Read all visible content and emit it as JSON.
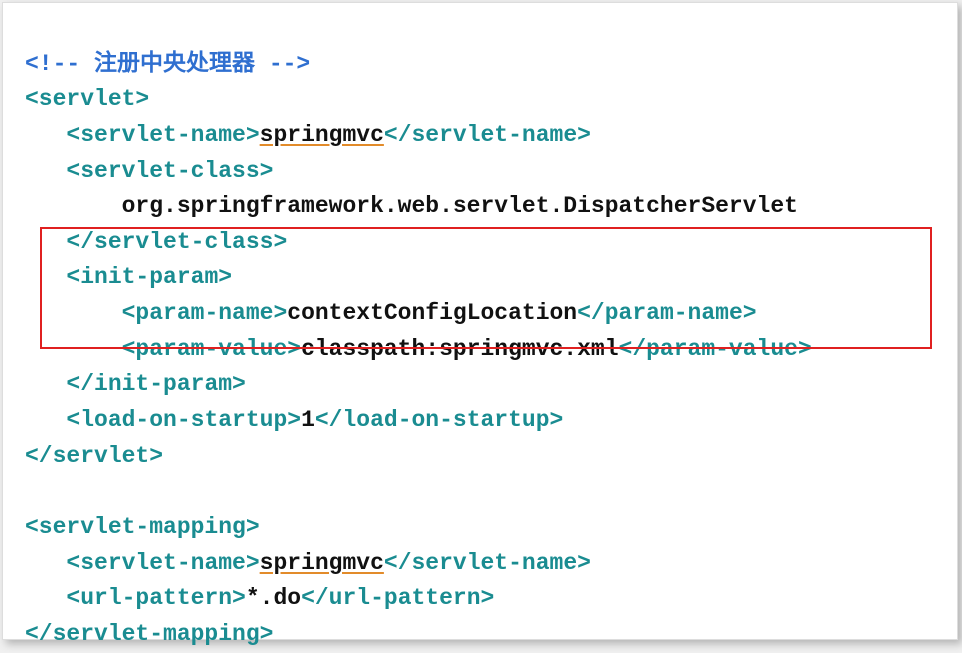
{
  "l1_open": "<!-- ",
  "l1_text": "注册中央处理器",
  "l1_close": " -->",
  "l2": "<servlet>",
  "l3_open": "<servlet-name>",
  "l3_text": "springmvc",
  "l3_close": "</servlet-name>",
  "l4": "<servlet-class>",
  "l5": "org.springframework.web.servlet.DispatcherServlet",
  "l6": "</servlet-class>",
  "l7": "<init-param>",
  "l8_open": "<param-name>",
  "l8_text": "contextConfigLocation",
  "l8_close": "</param-name>",
  "l9_open": "<param-value>",
  "l9_text": "classpath:springmvc.xml",
  "l9_close": "</param-value>",
  "l10": "</init-param>",
  "l11_open": "<load-on-startup>",
  "l11_text": "1",
  "l11_close": "</load-on-startup>",
  "l12": "</servlet>",
  "l13": "<servlet-mapping>",
  "l14_open": "<servlet-name>",
  "l14_text": "springmvc",
  "l14_close": "</servlet-name>",
  "l15_open": "<url-pattern>",
  "l15_text": "*.do",
  "l15_close": "</url-pattern>",
  "l16": "</servlet-mapping>"
}
